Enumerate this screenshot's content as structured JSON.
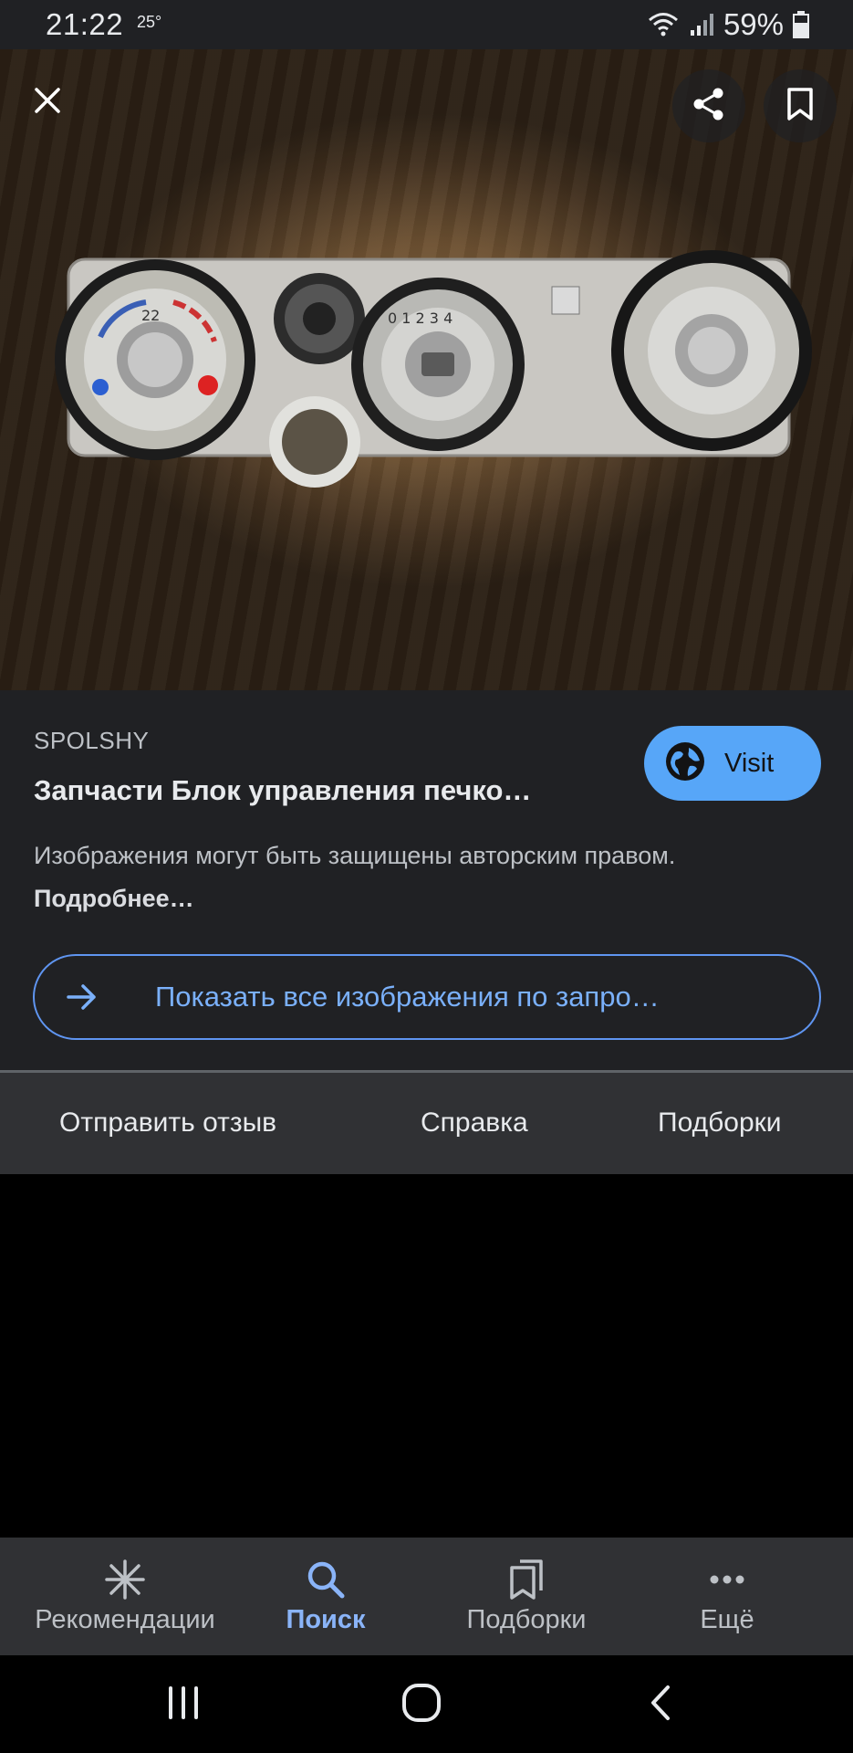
{
  "status_bar": {
    "time": "21:22",
    "temperature": "25°",
    "battery": "59%"
  },
  "viewer": {
    "close_icon": "close-icon",
    "share_icon": "share-icon",
    "bookmark_icon": "bookmark-icon"
  },
  "result": {
    "source": "SPOLSHY",
    "title": "Запчасти Блок управления печко…",
    "visit_label": "Visit",
    "copyright_text": "Изображения могут быть защищены авторским правом. ",
    "copyright_link": "Подробнее…",
    "show_all_label": "Показать все изображения по запро…"
  },
  "footer": {
    "feedback": "Отправить отзыв",
    "help": "Справка",
    "collections": "Подборки"
  },
  "bottom_nav": {
    "items": [
      {
        "label": "Рекомендации",
        "icon": "asterisk-icon",
        "active": false
      },
      {
        "label": "Поиск",
        "icon": "search-icon",
        "active": true
      },
      {
        "label": "Подборки",
        "icon": "collections-icon",
        "active": false
      },
      {
        "label": "Ещё",
        "icon": "more-icon",
        "active": false
      }
    ]
  },
  "colors": {
    "accent": "#8ab4f8",
    "visit_button": "#57a6f8",
    "panel": "#202124",
    "nav": "#303134"
  }
}
